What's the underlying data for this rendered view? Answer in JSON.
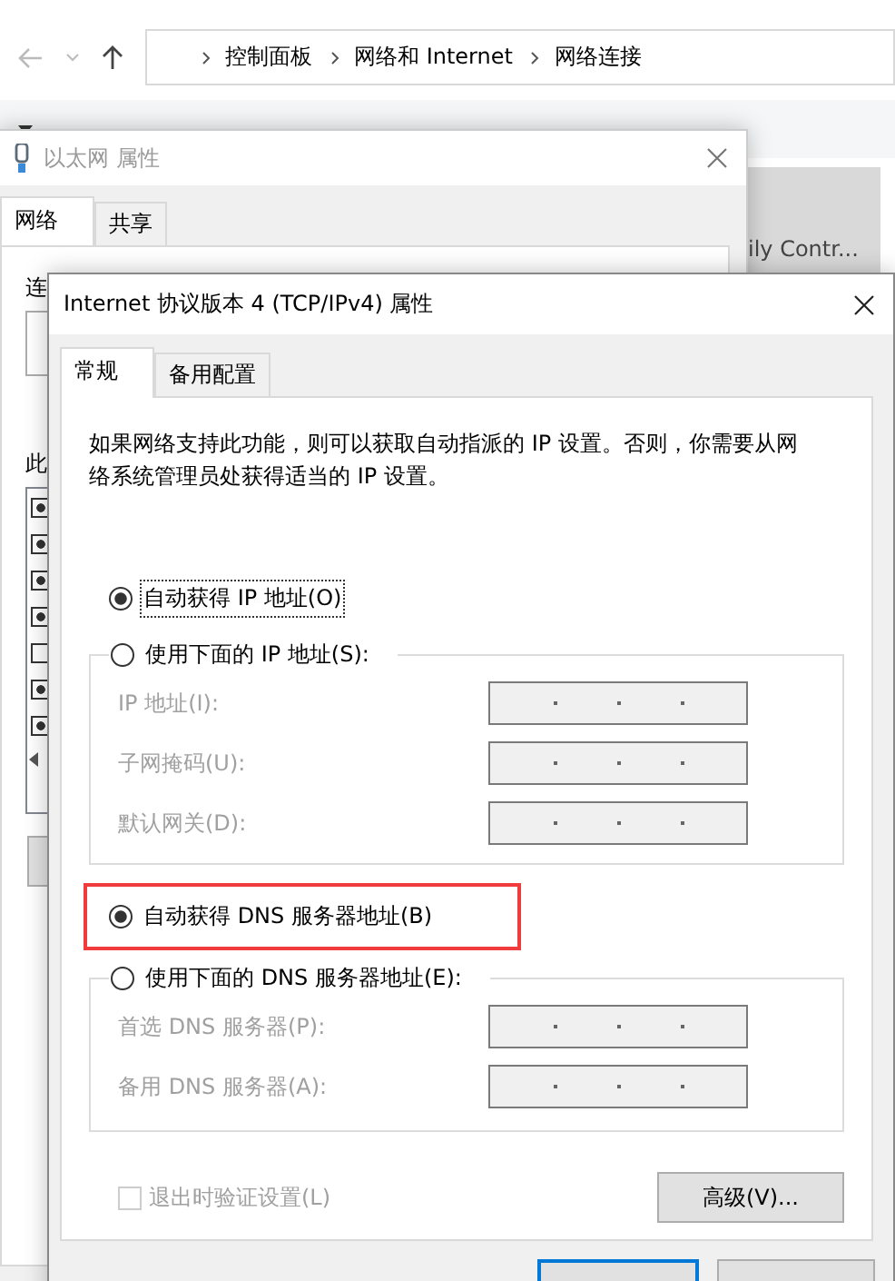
{
  "explorer": {
    "breadcrumbs": [
      "控制面板",
      "网络和 Internet",
      "网络连接"
    ],
    "background_item": "ily Contr..."
  },
  "ethernet_dialog": {
    "title": "以太网 属性",
    "tabs": [
      {
        "label": "网络",
        "selected": true
      },
      {
        "label": "共享",
        "selected": false
      }
    ],
    "connect_label": "连",
    "items_label": "此",
    "components": [
      {
        "checked": true
      },
      {
        "checked": true
      },
      {
        "checked": true
      },
      {
        "checked": true
      },
      {
        "checked": false
      },
      {
        "checked": true
      },
      {
        "checked": true
      }
    ]
  },
  "ipv4_dialog": {
    "title": "Internet 协议版本 4 (TCP/IPv4) 属性",
    "tabs": [
      {
        "label": "常规",
        "selected": true
      },
      {
        "label": "备用配置",
        "selected": false
      }
    ],
    "description": "如果网络支持此功能，则可以获取自动指派的 IP 设置。否则，你需要从网络系统管理员处获得适当的 IP 设置。",
    "ip_mode": [
      {
        "label": "自动获得 IP 地址(O)",
        "selected": true,
        "focused": true
      },
      {
        "label": "使用下面的 IP 地址(S):",
        "selected": false,
        "focused": false
      }
    ],
    "ip_fields": [
      {
        "label": "IP 地址(I):",
        "disabled": true
      },
      {
        "label": "子网掩码(U):",
        "disabled": true
      },
      {
        "label": "默认网关(D):",
        "disabled": true
      }
    ],
    "dns_mode": [
      {
        "label": "自动获得 DNS 服务器地址(B)",
        "selected": true,
        "highlighted": true
      },
      {
        "label": "使用下面的 DNS 服务器地址(E):",
        "selected": false,
        "highlighted": false
      }
    ],
    "dns_fields": [
      {
        "label": "首选 DNS 服务器(P):",
        "disabled": true
      },
      {
        "label": "备用 DNS 服务器(A):",
        "disabled": true
      }
    ],
    "validate": {
      "label": "退出时验证设置(L)",
      "checked": false,
      "disabled": true
    },
    "advanced_button": "高级(V)..."
  }
}
